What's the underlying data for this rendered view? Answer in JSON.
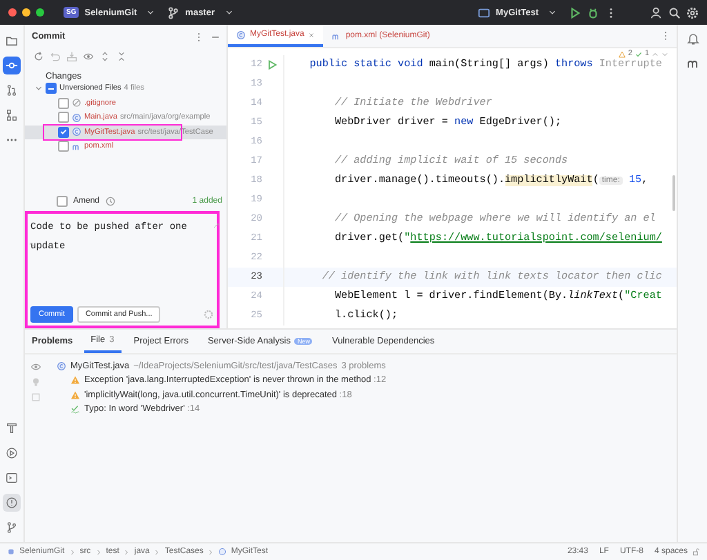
{
  "titlebar": {
    "project_badge": "SG",
    "project": "SeleniumGit",
    "branch": "master",
    "run_config": "MyGitTest"
  },
  "left_toolbar": [
    {
      "kind": "folder",
      "selected": false
    },
    {
      "kind": "commit",
      "selected": true
    },
    {
      "kind": "pull",
      "selected": false
    },
    {
      "kind": "structure",
      "selected": false
    },
    {
      "kind": "more",
      "selected": false
    }
  ],
  "left_toolbar_bottom": [
    {
      "kind": "hammer",
      "selected": false
    },
    {
      "kind": "run",
      "selected": false
    },
    {
      "kind": "terminal",
      "selected": false
    },
    {
      "kind": "problems",
      "selected": true
    },
    {
      "kind": "git",
      "selected": false
    }
  ],
  "commit_panel": {
    "title": "Commit",
    "changes_label": "Changes",
    "group": {
      "label": "Unversioned Files",
      "count": "4 files",
      "partial": true
    },
    "files": [
      {
        "name": ".gitignore",
        "kind": "ignore",
        "checked": false,
        "selected": false
      },
      {
        "name": "Main.java",
        "path": "src/main/java/org/example",
        "kind": "class",
        "checked": false,
        "selected": false
      },
      {
        "name": "MyGitTest.java",
        "path": "src/test/java/TestCase",
        "kind": "class",
        "checked": true,
        "selected": true
      },
      {
        "name": "pom.xml",
        "kind": "maven",
        "checked": false,
        "selected": false
      }
    ],
    "amend": {
      "label": "Amend",
      "checked": false
    },
    "added": "1 added",
    "message": "Code to be pushed after one update",
    "buttons": [
      {
        "label": "Commit",
        "primary": true
      },
      {
        "label": "Commit and Push...",
        "primary": false
      }
    ]
  },
  "editor": {
    "tabs": [
      {
        "label": "MyGitTest.java",
        "kind": "class",
        "selected": true
      },
      {
        "label": "pom.xml (SeleniumGit)",
        "kind": "maven",
        "selected": false
      }
    ],
    "inspections": {
      "warnings": "2",
      "typos": "1"
    },
    "lines": [
      {
        "number": "12",
        "run": true,
        "current": false,
        "tokens": [
          {
            "text": "    public static void ",
            "kind": "kw"
          },
          {
            "text": "main(String[] args) ",
            "kind": "plain"
          },
          {
            "text": "throws ",
            "kind": "kw"
          },
          {
            "text": "Interrupte",
            "kind": "faded"
          }
        ]
      },
      {
        "number": "13",
        "run": false,
        "current": false
      },
      {
        "number": "14",
        "run": false,
        "current": false,
        "tokens": [
          {
            "text": "        // Initiate the Webdriver",
            "kind": "comment"
          }
        ]
      },
      {
        "number": "15",
        "run": false,
        "current": false,
        "tokens": [
          {
            "text": "        WebDriver driver = ",
            "kind": "plain"
          },
          {
            "text": "new ",
            "kind": "kw"
          },
          {
            "text": "EdgeDriver();",
            "kind": "plain"
          }
        ]
      },
      {
        "number": "16",
        "run": false,
        "current": false
      },
      {
        "number": "17",
        "run": false,
        "current": false,
        "tokens": [
          {
            "text": "        // adding implicit wait of 15 seconds",
            "kind": "comment"
          }
        ]
      },
      {
        "number": "18",
        "run": false,
        "current": false,
        "tokens": [
          {
            "text": "        driver.manage().timeouts().",
            "kind": "plain"
          },
          {
            "text": "implicitlyWait",
            "kind": "deprecated"
          },
          {
            "text": "(",
            "kind": "plain"
          },
          {
            "text": "time:",
            "kind": "hint"
          },
          {
            "text": " 15",
            "kind": "num"
          },
          {
            "text": ", ",
            "kind": "plain"
          }
        ]
      },
      {
        "number": "19",
        "run": false,
        "current": false
      },
      {
        "number": "20",
        "run": false,
        "current": false,
        "tokens": [
          {
            "text": "        // Opening the webpage where we will identify an el",
            "kind": "comment"
          }
        ]
      },
      {
        "number": "21",
        "run": false,
        "current": false,
        "tokens": [
          {
            "text": "        driver.get(",
            "kind": "plain"
          },
          {
            "text": "\"",
            "kind": "string"
          },
          {
            "text": "https://www.tutorialspoint.com/selenium/",
            "kind": "link"
          }
        ]
      },
      {
        "number": "22",
        "run": false,
        "current": false
      },
      {
        "number": "23",
        "run": false,
        "current": true,
        "tokens": [
          {
            "text": "      // identify the link with link texts locator then clic",
            "kind": "comment"
          }
        ]
      },
      {
        "number": "24",
        "run": false,
        "current": false,
        "tokens": [
          {
            "text": "        WebElement l = driver.findElement(By.",
            "kind": "plain"
          },
          {
            "text": "linkText",
            "kind": "static"
          },
          {
            "text": "(",
            "kind": "plain"
          },
          {
            "text": "\"Creat",
            "kind": "string"
          }
        ]
      },
      {
        "number": "25",
        "run": false,
        "current": false,
        "tokens": [
          {
            "text": "        l.click();",
            "kind": "plain"
          }
        ]
      }
    ]
  },
  "problems": {
    "title": "Problems",
    "tabs": [
      {
        "label": "File",
        "count": "3",
        "selected": true
      },
      {
        "label": "Project Errors",
        "selected": false
      },
      {
        "label": "Server-Side Analysis",
        "badge": "New",
        "selected": false
      },
      {
        "label": "Vulnerable Dependencies",
        "selected": false
      }
    ],
    "file": {
      "name": "MyGitTest.java",
      "path": "~/IdeaProjects/SeleniumGit/src/test/java/TestCases",
      "summary": "3 problems",
      "children": [
        {
          "kind": "warning",
          "text": "Exception 'java.lang.InterruptedException' is never thrown in the method",
          "location": ":12"
        },
        {
          "kind": "warning",
          "text": "'implicitlyWait(long, java.util.concurrent.TimeUnit)' is deprecated",
          "location": ":18"
        },
        {
          "kind": "typo",
          "text": "Typo: In word 'Webdriver'",
          "location": ":14"
        }
      ]
    }
  },
  "status_bar": {
    "breadcrumbs": [
      "SeleniumGit",
      "src",
      "test",
      "java",
      "TestCases",
      "MyGitTest"
    ],
    "position": "23:43",
    "line_ending": "LF",
    "encoding": "UTF-8",
    "indent": "4 spaces"
  }
}
